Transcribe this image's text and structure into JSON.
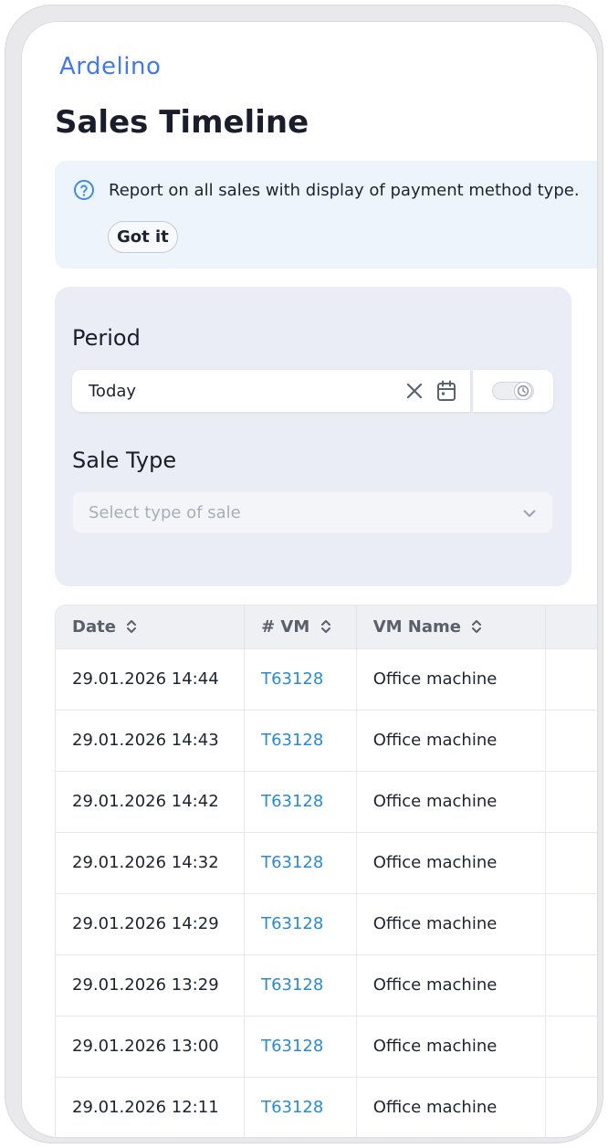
{
  "app": {
    "brand": "Ardelino"
  },
  "page": {
    "title": "Sales Timeline"
  },
  "info": {
    "icon": "question-circle-icon",
    "text": "Report on all sales with display of payment method type.",
    "dismiss_label": "Got it"
  },
  "filters": {
    "period_label": "Period",
    "period_value": "Today",
    "sale_type_label": "Sale Type",
    "sale_type_placeholder": "Select type of sale"
  },
  "table": {
    "columns": [
      "Date",
      "# VM",
      "VM Name"
    ],
    "rows": [
      {
        "date": "29.01.2026 14:44",
        "vm": "T63128",
        "name": "Office machine"
      },
      {
        "date": "29.01.2026 14:43",
        "vm": "T63128",
        "name": "Office machine"
      },
      {
        "date": "29.01.2026 14:42",
        "vm": "T63128",
        "name": "Office machine"
      },
      {
        "date": "29.01.2026 14:32",
        "vm": "T63128",
        "name": "Office machine"
      },
      {
        "date": "29.01.2026 14:29",
        "vm": "T63128",
        "name": "Office machine"
      },
      {
        "date": "29.01.2026 13:29",
        "vm": "T63128",
        "name": "Office machine"
      },
      {
        "date": "29.01.2026 13:00",
        "vm": "T63128",
        "name": "Office machine"
      },
      {
        "date": "29.01.2026 12:11",
        "vm": "T63128",
        "name": "Office machine"
      }
    ]
  },
  "colors": {
    "brand": "#4479e8",
    "link": "#2a8bd0",
    "info_bg": "#eef4fc",
    "filter_bg": "#eaedf5"
  }
}
